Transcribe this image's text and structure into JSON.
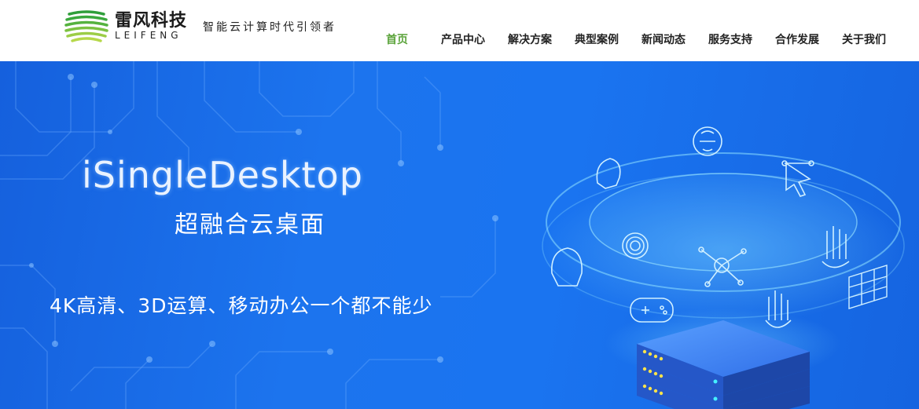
{
  "brand": {
    "name_cn": "雷风科技",
    "name_en": "LEIFENG",
    "slogan": "智能云计算时代引领者",
    "logo_colors": [
      "#2f9e3a",
      "#7cc242",
      "#b6d84a"
    ]
  },
  "nav": {
    "items": [
      {
        "label": "首页",
        "active": true
      },
      {
        "label": "产品中心",
        "active": false
      },
      {
        "label": "解决方案",
        "active": false
      },
      {
        "label": "典型案例",
        "active": false
      },
      {
        "label": "新闻动态",
        "active": false
      },
      {
        "label": "服务支持",
        "active": false
      },
      {
        "label": "合作发展",
        "active": false
      },
      {
        "label": "关于我们",
        "active": false
      }
    ],
    "active_color": "#5aa33a"
  },
  "hero": {
    "title": "iSingleDesktop",
    "subtitle": "超融合云桌面",
    "tagline": "4K高清、3D运算、移动办公一个都不能少",
    "bg_color": "#1a6fe8"
  },
  "illustration": {
    "icons": [
      "brain-icon",
      "head-profile-icon",
      "cursor-network-icon",
      "fingerprint-icon",
      "hand-scan-icon",
      "face-scan-icon",
      "node-graph-icon",
      "gamepad-icon",
      "palm-icon",
      "grid-panel-icon"
    ]
  }
}
